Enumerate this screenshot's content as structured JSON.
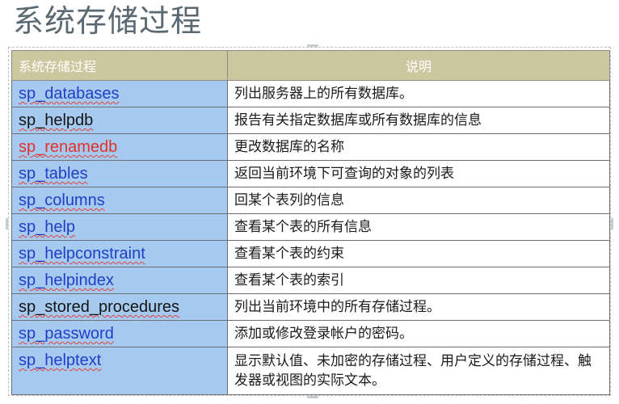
{
  "title": "系统存储过程",
  "table": {
    "headers": [
      "系统存储过程",
      "说明"
    ],
    "rows": [
      {
        "name": "sp_databases",
        "desc": "列出服务器上的所有数据库。",
        "color": "#1f3fc7"
      },
      {
        "name": "sp_helpdb",
        "desc": "报告有关指定数据库或所有数据库的信息",
        "color": "#151515"
      },
      {
        "name": "sp_renamedb",
        "desc": "更改数据库的名称",
        "color": "#e3312a"
      },
      {
        "name": "sp_tables",
        "desc": "返回当前环境下可查询的对象的列表",
        "color": "#1f3fc7"
      },
      {
        "name": "sp_columns",
        "desc": "回某个表列的信息",
        "color": "#1f3fc7"
      },
      {
        "name": "sp_help",
        "desc": "查看某个表的所有信息",
        "color": "#1f3fc7"
      },
      {
        "name": "sp_helpconstraint",
        "desc": "查看某个表的约束",
        "color": "#1f3fc7"
      },
      {
        "name": "sp_helpindex",
        "desc": "查看某个表的索引",
        "color": "#1f3fc7"
      },
      {
        "name": "sp_stored_procedures",
        "desc": "列出当前环境中的所有存储过程。",
        "color": "#151515"
      },
      {
        "name": "sp_password",
        "desc": "添加或修改登录帐户的密码。",
        "color": "#1f3fc7"
      },
      {
        "name": "sp_helptext",
        "desc": "显示默认值、未加密的存储过程、用户定义的存储过程、触发器或视图的实际文本。",
        "color": "#1f3fc7"
      }
    ]
  },
  "colors": {
    "header_bg": "#cdc7a0",
    "name_col_bg": "#a6c9ef",
    "title_color": "#5a6872"
  }
}
